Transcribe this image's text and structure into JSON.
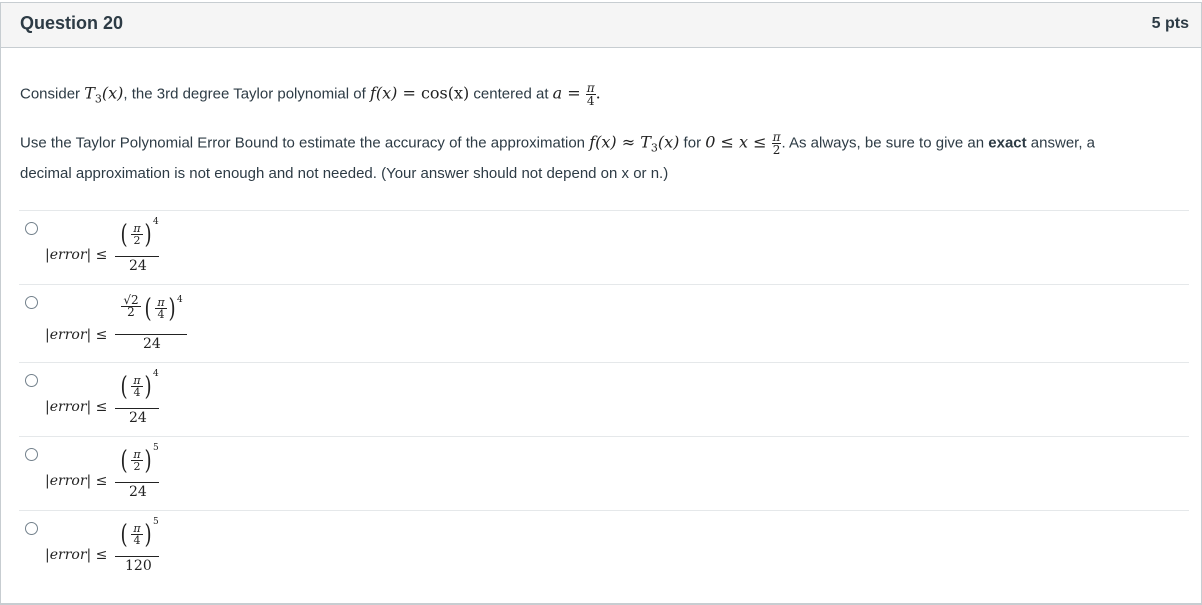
{
  "question": {
    "title": "Question 20",
    "points": "5 pts"
  },
  "prompt": {
    "line1_a": "Consider ",
    "line1_T": "T",
    "line1_sub": "3",
    "line1_b": "(x)",
    "line1_c": ", the 3rd degree Taylor polynomial of ",
    "line1_f": "f(x) = ",
    "line1_cos": "cos(x)",
    "line1_d": " centered at ",
    "line1_a_eq": "a = ",
    "pi": "π",
    "four": "4",
    "two": "2",
    "line2_a": "Use the Taylor Polynomial Error Bound to estimate the accuracy of the approximation ",
    "line2_f": "f(x) ≈ T",
    "line2_sub": "3",
    "line2_x": "(x)",
    "line2_for": " for ",
    "line2_ineq": "0 ≤ x ≤ ",
    "line2_b": ". As always, be sure to give an ",
    "line2_exact": "exact",
    "line2_c": " answer, a",
    "line3": "decimal approximation is not enough and not needed. (Your answer should not depend on x or n.)"
  },
  "answers": [
    {
      "label": "|error| ≤",
      "prefix": "",
      "inner_den": "2",
      "exponent": "4",
      "denominator": "24"
    },
    {
      "label": "|error| ≤",
      "prefix": "√2/2",
      "inner_den": "4",
      "exponent": "4",
      "denominator": "24"
    },
    {
      "label": "|error| ≤",
      "prefix": "",
      "inner_den": "4",
      "exponent": "4",
      "denominator": "24"
    },
    {
      "label": "|error| ≤",
      "prefix": "",
      "inner_den": "2",
      "exponent": "5",
      "denominator": "24"
    },
    {
      "label": "|error| ≤",
      "prefix": "",
      "inner_den": "4",
      "exponent": "5",
      "denominator": "120"
    }
  ],
  "sqrt2_num": "√2",
  "sqrt2_den": "2"
}
